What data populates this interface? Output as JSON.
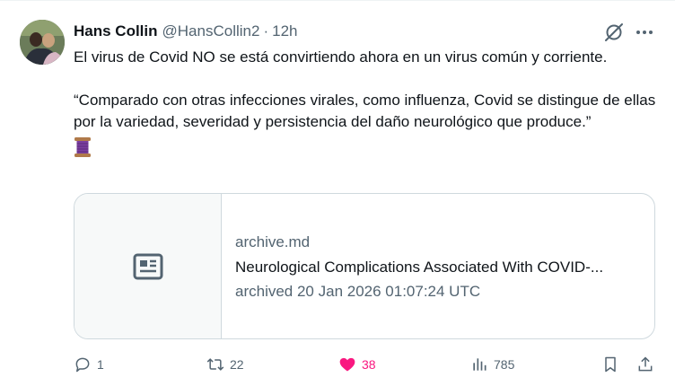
{
  "tweet": {
    "author_name": "Hans Collin",
    "author_handle": "@HansCollin2",
    "separator": "·",
    "time": "12h",
    "paragraph1": "El virus de Covid NO se está convirtiendo ahora en un virus común y corriente.",
    "paragraph2": "“Comparado con otras infecciones virales, como influenza, Covid se distingue de ellas por la variedad, severidad y persistencia del daño neurológico que produce.”",
    "emoji": "thread-spool",
    "icons": [
      "grok-icon",
      "more-icon"
    ]
  },
  "card": {
    "domain": "archive.md",
    "title": "Neurological Complications Associated With COVID-...",
    "description": "archived 20 Jan 2026 01:07:24 UTC",
    "thumbnail_icon": "article-icon"
  },
  "actions": {
    "replies": "1",
    "retweets": "22",
    "likes": "38",
    "views": "785"
  },
  "colors": {
    "text": "#0f1419",
    "secondary": "#536471",
    "like": "#f91880",
    "border": "#cfd9de"
  }
}
